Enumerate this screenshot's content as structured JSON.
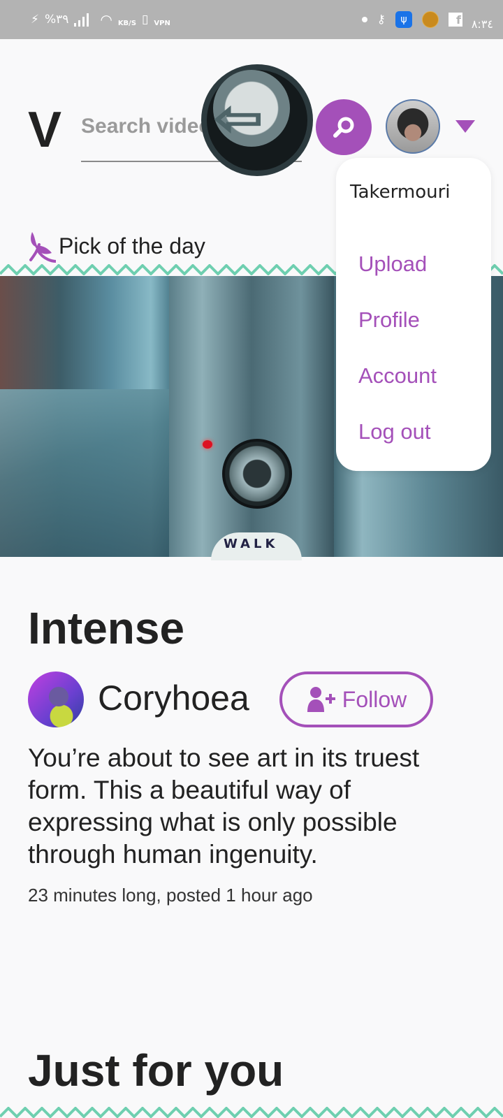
{
  "status_bar": {
    "battery": "%٣٩",
    "speed": "KB/S",
    "vpn": "VPN",
    "time": "٨:٣٤",
    "icons": [
      "charging-icon",
      "signal-icon",
      "wifi-icon",
      "vibrate-icon",
      "vpn-icon",
      "dot-icon",
      "key-icon",
      "usb-icon",
      "coin-icon",
      "facebook-icon"
    ]
  },
  "header": {
    "logo": "V",
    "search_placeholder": "Search videos",
    "search_value": ""
  },
  "user_menu": {
    "username": "Takermouri",
    "items": [
      "Upload",
      "Profile",
      "Account",
      "Log out"
    ]
  },
  "pick_of_day": {
    "label": "Pick of the day",
    "hero_sign_text": "WALK"
  },
  "video": {
    "title": "Intense",
    "author": "Coryhoea",
    "follow_label": "Follow",
    "description": "You’re about to see art in its truest form. This a beautiful way of expressing what is only possible through human ingenuity.",
    "meta": "23 minutes long, posted 1 hour ago"
  },
  "section": {
    "title": "Just for you"
  },
  "colors": {
    "accent": "#a450b9",
    "zigzag": "#6fcfb0",
    "status_bar": "#b3b3b3",
    "background": "#f9f9fa"
  }
}
